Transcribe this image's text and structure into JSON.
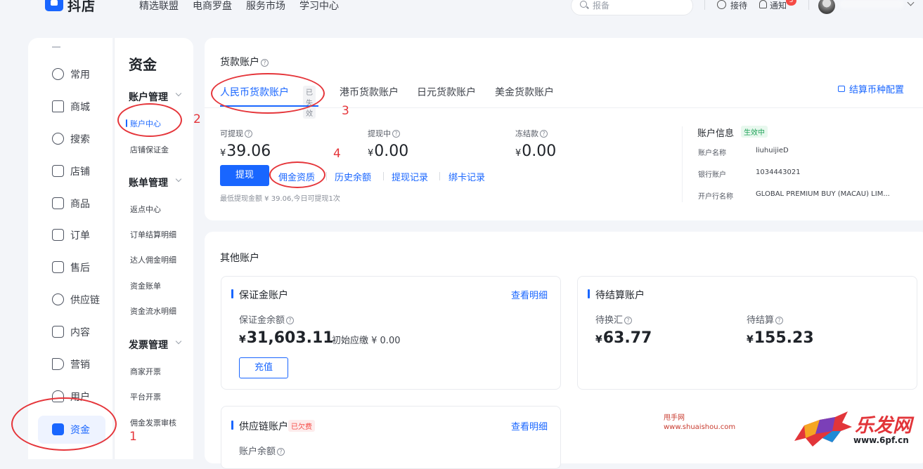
{
  "topbar": {
    "brand": "抖店",
    "nav": [
      "精选联盟",
      "电商罗盘",
      "服务市场",
      "学习中心"
    ],
    "search_placeholder": "报备",
    "reception": "接待",
    "notification": "通知",
    "notification_count": "3"
  },
  "rail": {
    "items": [
      {
        "label": "常用",
        "icon": "clock-icon"
      },
      {
        "label": "商城",
        "icon": "home-icon"
      },
      {
        "label": "搜索",
        "icon": "search-icon"
      },
      {
        "label": "店铺",
        "icon": "shop-icon"
      },
      {
        "label": "商品",
        "icon": "product-icon"
      },
      {
        "label": "订单",
        "icon": "order-icon"
      },
      {
        "label": "售后",
        "icon": "after-sale-icon"
      },
      {
        "label": "供应链",
        "icon": "supply-chain-icon"
      },
      {
        "label": "内容",
        "icon": "content-icon"
      },
      {
        "label": "营销",
        "icon": "megaphone-icon"
      },
      {
        "label": "用户",
        "icon": "user-icon"
      },
      {
        "label": "资金",
        "icon": "wallet-icon"
      }
    ]
  },
  "submenu": {
    "title": "资金",
    "groups": [
      {
        "label": "账户管理",
        "items": [
          "账户中心",
          "店铺保证金"
        ]
      },
      {
        "label": "账单管理",
        "items": [
          "返点中心",
          "订单结算明细",
          "达人佣金明细",
          "资金账单",
          "资金流水明细"
        ]
      },
      {
        "label": "发票管理",
        "items": [
          "商家开票",
          "平台开票",
          "佣金发票审核"
        ]
      }
    ]
  },
  "payment_account": {
    "title": "货款账户",
    "tabs": [
      {
        "label": "人民币货款账户",
        "tag": "已失效"
      },
      {
        "label": "港币货款账户"
      },
      {
        "label": "日元货款账户"
      },
      {
        "label": "美金货款账户"
      }
    ],
    "currency_config": "结算币种配置",
    "withdrawable": {
      "label": "可提现",
      "currency": "¥",
      "value": "39.06"
    },
    "withdrawing": {
      "label": "提现中",
      "currency": "¥",
      "value": "0.00"
    },
    "frozen": {
      "label": "冻结款",
      "currency": "¥",
      "value": "0.00"
    },
    "withdraw_button": "提现",
    "links": [
      "佣金资质",
      "历史余额",
      "提现记录",
      "绑卡记录"
    ],
    "hint": "最低提现金额 ¥ 39.06,今日可提现1次",
    "info": {
      "title": "账户信息",
      "status": "生效中",
      "rows": [
        {
          "key": "账户名称",
          "value": "liuhuijieD"
        },
        {
          "key": "银行账户",
          "value": "1034443021"
        },
        {
          "key": "开户行名称",
          "value": "GLOBAL PREMIUM BUY (MACAU) LIM..."
        }
      ]
    }
  },
  "other_accounts": {
    "title": "其他账户",
    "deposit": {
      "title": "保证金账户",
      "detail_link": "查看明细",
      "balance_label": "保证金余额",
      "currency": "¥",
      "balance": "31,603.11",
      "initial": "初始应缴 ¥ 0.00",
      "recharge_button": "充值"
    },
    "pending": {
      "title": "待结算账户",
      "exchange_label": "待换汇",
      "exchange_value": "63.77",
      "settle_label": "待结算",
      "settle_value": "155.23",
      "currency": "¥"
    },
    "supply": {
      "title": "供应链账户",
      "tag": "已欠费",
      "detail_link": "查看明细",
      "balance_label": "账户余额"
    }
  },
  "annotations": [
    "1",
    "2",
    "3",
    "4"
  ],
  "watermark": {
    "line1": "甩手网",
    "line2": "www.shuaishou.com",
    "brand": "乐发网",
    "url": "www.6pf.cn"
  },
  "colors": {
    "accent": "#1966ff",
    "annotation": "#e5353a",
    "success": "#21a35a",
    "danger": "#f54a45"
  }
}
